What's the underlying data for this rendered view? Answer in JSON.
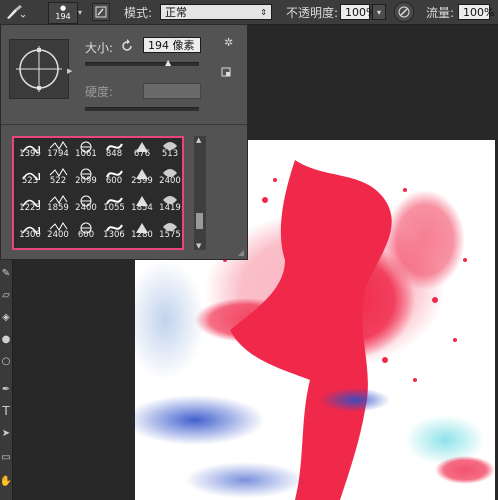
{
  "options_bar": {
    "brush_size": "194",
    "mode_label": "模式:",
    "mode_value": "正常",
    "opacity_label": "不透明度:",
    "opacity_value": "100%",
    "flow_label": "流量:",
    "flow_value": "100%"
  },
  "brush_panel": {
    "size_label": "大小:",
    "size_value": "194 像素",
    "hardness_label": "硬度:",
    "brushes": [
      [
        "1399",
        "1794",
        "1061",
        "848",
        "676",
        "513"
      ],
      [
        "523",
        "522",
        "2099",
        "600",
        "2399",
        "2400"
      ],
      [
        "1223",
        "1859",
        "2400",
        "1055",
        "1854",
        "1419"
      ],
      [
        "1300",
        "2400",
        "600",
        "1306",
        "1280",
        "1575"
      ]
    ]
  },
  "colors": {
    "accent_highlight": "#e8457a",
    "splash_red": "#f0284a",
    "splash_blue": "#2c4fc8"
  },
  "icons": [
    "brush-tool-icon",
    "brush-preset-icon",
    "airbrush-icon",
    "gear-icon",
    "reset-icon",
    "new-preset-icon"
  ]
}
